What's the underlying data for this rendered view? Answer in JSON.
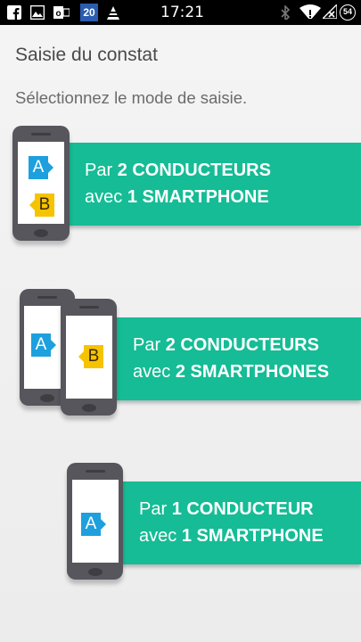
{
  "status_bar": {
    "time": "17:21",
    "calendar_day": "20",
    "battery_level": "54",
    "left_icons": [
      "facebook-icon",
      "gallery-icon",
      "outlook-icon",
      "calendar-icon",
      "vlc-icon"
    ],
    "right_icons": [
      "bluetooth-icon",
      "wifi-icon",
      "no-signal-icon",
      "battery-icon"
    ]
  },
  "page": {
    "title": "Saisie du constat",
    "subtitle": "Sélectionnez le mode de saisie."
  },
  "options": [
    {
      "line1_prefix": "Par ",
      "line1_bold": "2 CONDUCTEURS",
      "line2_prefix": "avec ",
      "line2_bold": "1 SMARTPHONE",
      "tags": [
        "A",
        "B"
      ]
    },
    {
      "line1_prefix": "Par ",
      "line1_bold": " 2 CONDUCTEURS",
      "line2_prefix": "avec ",
      "line2_bold": "2 SMARTPHONES",
      "tags": [
        "A",
        "B"
      ]
    },
    {
      "line1_prefix": "Par ",
      "line1_bold": "1 CONDUCTEUR",
      "line2_prefix": "avec ",
      "line2_bold": "1 SMARTPHONE",
      "tags": [
        "A"
      ]
    }
  ],
  "colors": {
    "banner": "#15bc95",
    "tag_a": "#1da0dd",
    "tag_b": "#f6c300",
    "phone_body": "#56565c"
  }
}
